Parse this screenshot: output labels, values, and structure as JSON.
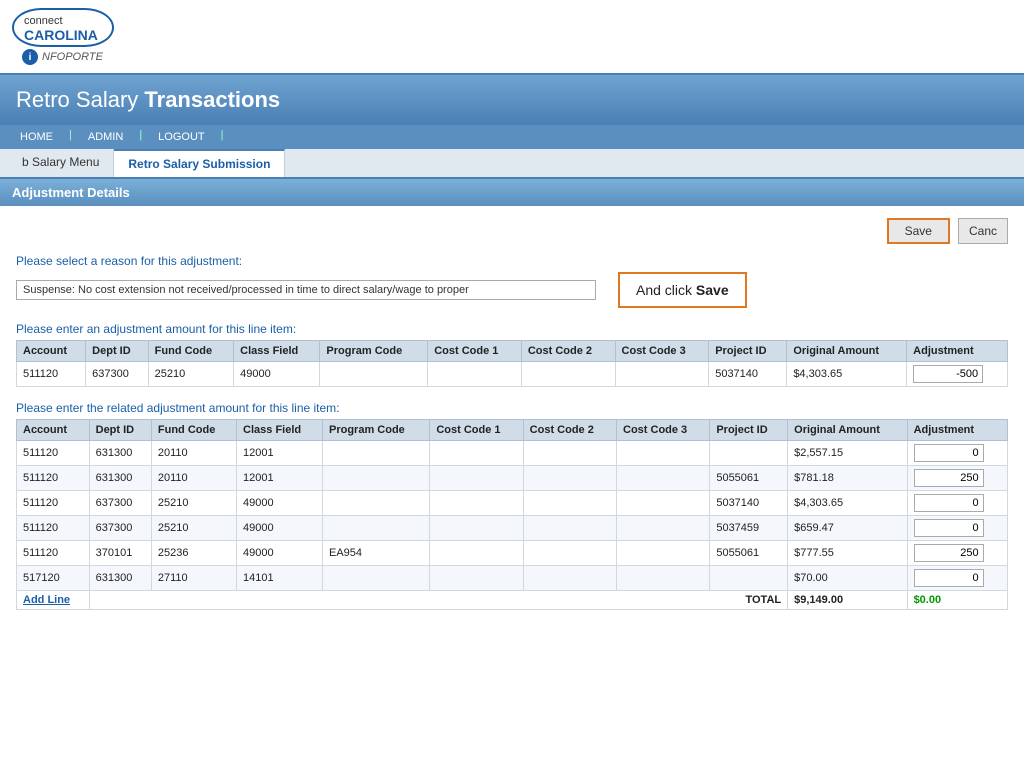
{
  "app": {
    "logo_connect": "connect",
    "logo_carolina": "CAROLINA",
    "logo_infoporte": "NFOPORTE",
    "info_char": "i"
  },
  "header": {
    "title_retro": "Retro ",
    "title_salary": "Salary ",
    "title_transactions": "Transactions"
  },
  "nav": {
    "home": "HOME",
    "admin": "ADMIN",
    "logout": "LOGOUT"
  },
  "tabs": [
    {
      "label": "b Salary Menu",
      "active": false
    },
    {
      "label": "Retro Salary Submission",
      "active": true
    }
  ],
  "section": {
    "title": "Adjustment Details"
  },
  "buttons": {
    "save": "Save",
    "cancel": "Canc"
  },
  "callout": {
    "text_before": "And click ",
    "text_bold": "Save"
  },
  "reason": {
    "label": "Please select a reason for this adjustment:",
    "value": "Suspense: No cost extension not received/processed in time to direct salary/wage to proper"
  },
  "line_item_label": "Please enter an adjustment amount for this line item:",
  "related_label": "Please enter the related adjustment amount for this line item:",
  "table1": {
    "columns": [
      "Account",
      "Dept ID",
      "Fund Code",
      "Class Field",
      "Program Code",
      "Cost Code 1",
      "Cost Code 2",
      "Cost Code 3",
      "Project ID",
      "Original Amount",
      "Adjustment"
    ],
    "rows": [
      {
        "account": "511120",
        "dept_id": "637300",
        "fund_code": "25210",
        "class_field": "49000",
        "program_code": "",
        "cc1": "",
        "cc2": "",
        "cc3": "",
        "project_id": "5037140",
        "original": "$4,303.65",
        "adjustment": "-500"
      }
    ]
  },
  "table2": {
    "columns": [
      "Account",
      "Dept ID",
      "Fund Code",
      "Class Field",
      "Program Code",
      "Cost Code 1",
      "Cost Code 2",
      "Cost Code 3",
      "Project ID",
      "Original Amount",
      "Adjustment"
    ],
    "rows": [
      {
        "account": "511120",
        "dept_id": "631300",
        "fund_code": "20110",
        "class_field": "12001",
        "program_code": "",
        "cc1": "",
        "cc2": "",
        "cc3": "",
        "project_id": "",
        "original": "$2,557.15",
        "adjustment": "0"
      },
      {
        "account": "511120",
        "dept_id": "631300",
        "fund_code": "20110",
        "class_field": "12001",
        "program_code": "",
        "cc1": "",
        "cc2": "",
        "cc3": "",
        "project_id": "5055061",
        "original": "$781.18",
        "adjustment": "250"
      },
      {
        "account": "511120",
        "dept_id": "637300",
        "fund_code": "25210",
        "class_field": "49000",
        "program_code": "",
        "cc1": "",
        "cc2": "",
        "cc3": "",
        "project_id": "5037140",
        "original": "$4,303.65",
        "adjustment": "0"
      },
      {
        "account": "511120",
        "dept_id": "637300",
        "fund_code": "25210",
        "class_field": "49000",
        "program_code": "",
        "cc1": "",
        "cc2": "",
        "cc3": "",
        "project_id": "5037459",
        "original": "$659.47",
        "adjustment": "0"
      },
      {
        "account": "511120",
        "dept_id": "370101",
        "fund_code": "25236",
        "class_field": "49000",
        "program_code": "EA954",
        "cc1": "",
        "cc2": "",
        "cc3": "",
        "project_id": "5055061",
        "original": "$777.55",
        "adjustment": "250"
      },
      {
        "account": "517120",
        "dept_id": "631300",
        "fund_code": "27110",
        "class_field": "14101",
        "program_code": "",
        "cc1": "",
        "cc2": "",
        "cc3": "",
        "project_id": "",
        "original": "$70.00",
        "adjustment": "0"
      }
    ],
    "total_label": "TOTAL",
    "total_original": "$9,149.00",
    "total_adjustment": "$0.00",
    "add_line": "Add Line"
  }
}
